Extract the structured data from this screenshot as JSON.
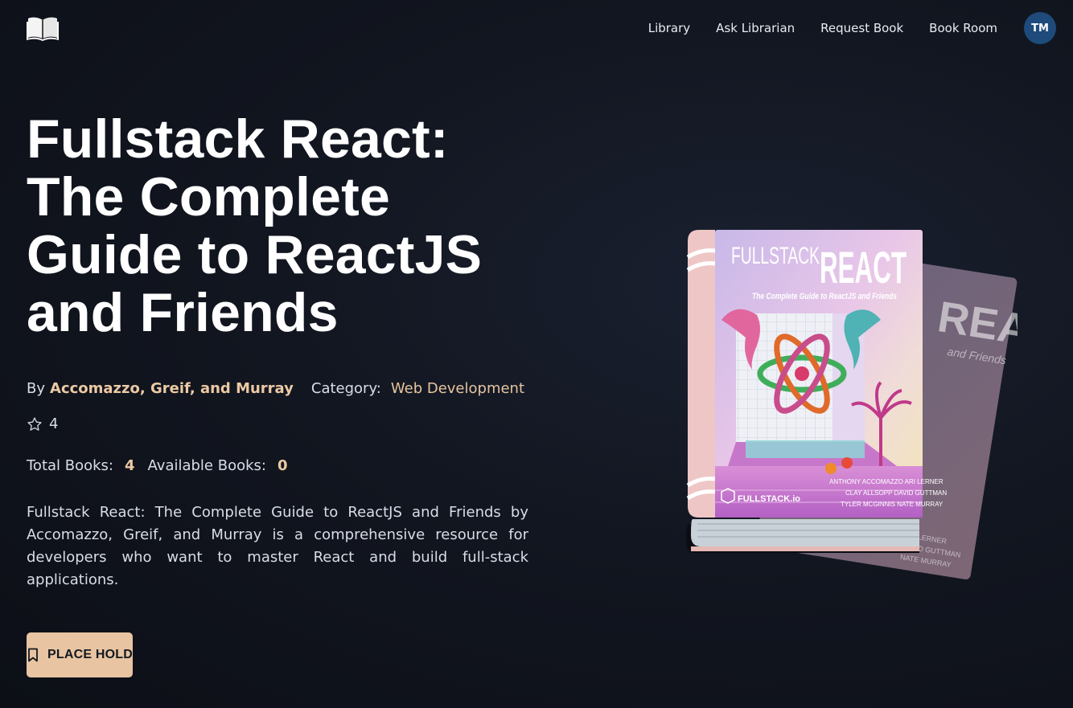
{
  "nav": {
    "items": [
      "Library",
      "Ask Librarian",
      "Request Book",
      "Book Room"
    ],
    "avatar_initials": "TM"
  },
  "book": {
    "title": "Fullstack React: The Complete Guide to ReactJS and Friends",
    "by_label": "By",
    "authors": "Accomazzo, Greif, and Murray",
    "category_label": "Category:",
    "category": "Web Development",
    "rating": "4",
    "total_label": "Total Books:",
    "total": "4",
    "available_label": "Available Books:",
    "available": "0",
    "description": "Fullstack React: The Complete Guide to ReactJS and Friends by Accomazzo, Greif, and Murray is a comprehensive resource for developers who want to master React and build full-stack applications.",
    "hold_button": "PLACE HOLD"
  },
  "cover": {
    "title_left": "FULLSTACK",
    "title_right": "REACT",
    "subtitle": "The Complete Guide to ReactJS and Friends",
    "authors_line1": "ANTHONY ACCOMAZZO  ARI LERNER",
    "authors_line2": "CLAY ALLSOPP  DAVID GUTTMAN",
    "authors_line3": "TYLER MCGINNIS  NATE MURRAY",
    "publisher": "FULLSTACK.io",
    "back_title": "REACT",
    "back_sub": "and Friends",
    "back_auth1": "ARI LERNER",
    "back_auth2": "DAVID GUTTMAN",
    "back_auth3": "NATE MURRAY"
  },
  "colors": {
    "accent": "#e8c4a2",
    "avatar": "#1e4b7c",
    "background": "#0f1219"
  },
  "icons": {
    "logo": "open-book-icon",
    "rating": "star-outline-icon",
    "hold": "bookmark-icon"
  }
}
